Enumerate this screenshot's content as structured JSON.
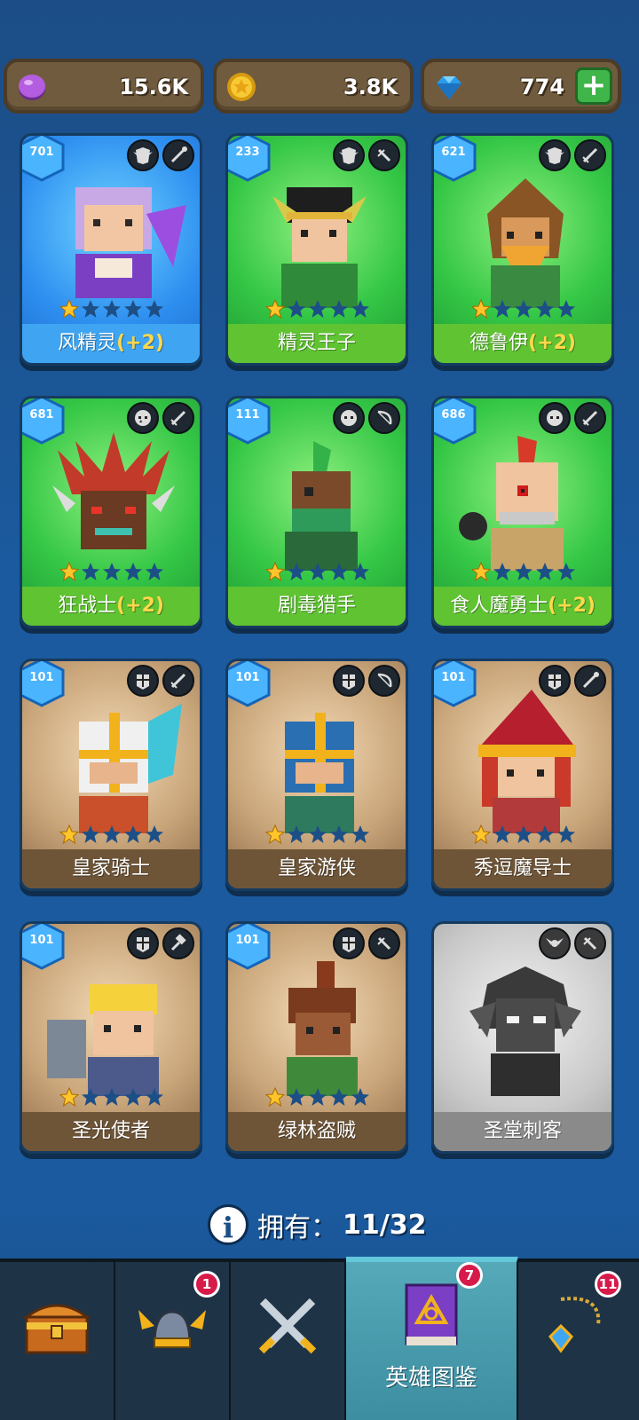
{
  "currencies": [
    {
      "icon": "purple-gem-coin-icon",
      "value": "15.6K"
    },
    {
      "icon": "gold-coin-icon",
      "value": "3.8K"
    },
    {
      "icon": "diamond-icon",
      "value": "774",
      "plus": "+"
    }
  ],
  "heroes": [
    {
      "level": "701",
      "name": "风精灵",
      "bonus": "(+2)",
      "rarity": "epic",
      "stars": 1,
      "faction_icon": "elf-faction-icon",
      "weapon_icon": "wand-icon"
    },
    {
      "level": "233",
      "name": "精灵王子",
      "bonus": "",
      "rarity": "rare",
      "stars": 1,
      "faction_icon": "elf-faction-icon",
      "weapon_icon": "dagger-icon"
    },
    {
      "level": "621",
      "name": "德鲁伊",
      "bonus": "(+2)",
      "rarity": "rare",
      "stars": 1,
      "faction_icon": "elf-faction-icon",
      "weapon_icon": "sword-icon"
    },
    {
      "level": "681",
      "name": "狂战士",
      "bonus": "(+2)",
      "rarity": "rare",
      "stars": 1,
      "faction_icon": "orc-faction-icon",
      "weapon_icon": "sword-icon"
    },
    {
      "level": "111",
      "name": "剧毒猎手",
      "bonus": "",
      "rarity": "rare",
      "stars": 1,
      "faction_icon": "orc-faction-icon",
      "weapon_icon": "bow-icon"
    },
    {
      "level": "686",
      "name": "食人魔勇士",
      "bonus": "(+2)",
      "rarity": "rare",
      "stars": 1,
      "faction_icon": "orc-faction-icon",
      "weapon_icon": "sword-icon"
    },
    {
      "level": "101",
      "name": "皇家骑士",
      "bonus": "",
      "rarity": "common",
      "stars": 1,
      "faction_icon": "human-faction-icon",
      "weapon_icon": "sword-icon"
    },
    {
      "level": "101",
      "name": "皇家游侠",
      "bonus": "",
      "rarity": "common",
      "stars": 1,
      "faction_icon": "human-faction-icon",
      "weapon_icon": "bow-icon"
    },
    {
      "level": "101",
      "name": "秀逗魔导士",
      "bonus": "",
      "rarity": "common",
      "stars": 1,
      "faction_icon": "human-faction-icon",
      "weapon_icon": "wand-icon"
    },
    {
      "level": "101",
      "name": "圣光使者",
      "bonus": "",
      "rarity": "common",
      "stars": 1,
      "faction_icon": "human-faction-icon",
      "weapon_icon": "hammer-icon"
    },
    {
      "level": "101",
      "name": "绿林盗贼",
      "bonus": "",
      "rarity": "common",
      "stars": 1,
      "faction_icon": "human-faction-icon",
      "weapon_icon": "dagger-icon"
    },
    {
      "level": "",
      "name": "圣堂刺客",
      "bonus": "",
      "rarity": "locked",
      "stars": 0,
      "faction_icon": "winged-faction-icon",
      "weapon_icon": "dagger-icon"
    }
  ],
  "owned": {
    "label": "拥有：",
    "count": "11/32"
  },
  "nav": [
    {
      "id": "shop",
      "icon": "treasure-chest-icon",
      "label": "",
      "badge": ""
    },
    {
      "id": "heroes",
      "icon": "winged-helmet-icon",
      "label": "",
      "badge": "1"
    },
    {
      "id": "battle",
      "icon": "crossed-swords-icon",
      "label": "",
      "badge": ""
    },
    {
      "id": "codex",
      "icon": "spell-book-icon",
      "label": "英雄图鉴",
      "badge": "7"
    },
    {
      "id": "items",
      "icon": "amulet-icon",
      "label": "",
      "badge": "11"
    }
  ],
  "colors": {
    "background": "#1b5a9e",
    "epic": "#3fa5f2",
    "rare": "#5fc332",
    "common": "#6e5538",
    "locked": "#8a8a8a",
    "badge": "#d61a4a"
  }
}
